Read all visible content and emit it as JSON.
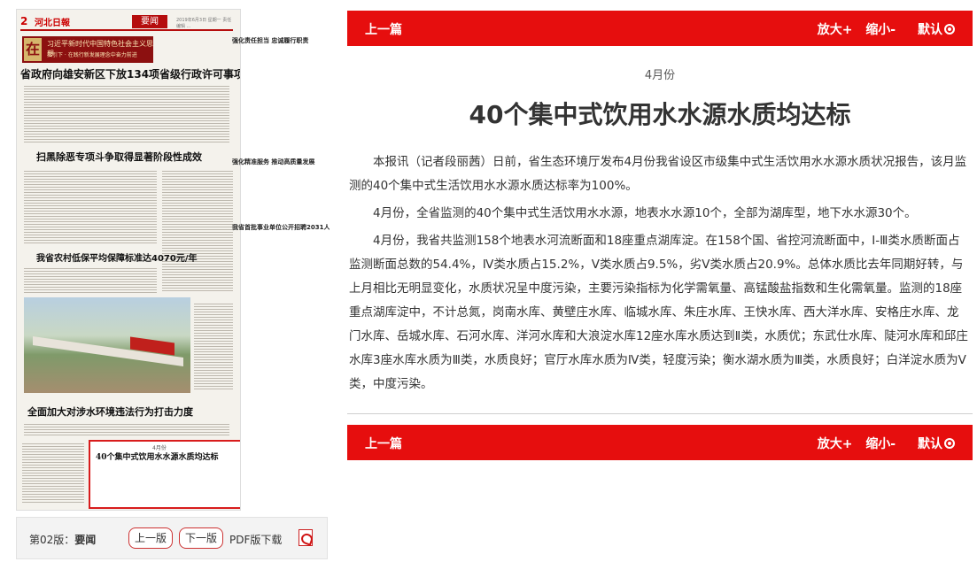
{
  "paper": {
    "page_number": "2",
    "logo": "河北日報",
    "section": "要闻",
    "date_line": "2019年6月3日 星期一 责任编辑 ...",
    "banner_char": "在",
    "banner_line1": "习近平新时代中国特色社会主义思想",
    "banner_line2": "指引下 · 在践行新发展理念中奋力前进",
    "headlines": [
      "省政府向雄安新区下放134项省级行政许可事项",
      "扫黑除恶专项斗争取得显著阶段性成效",
      "我省农村低保平均保障标准达4070元/年",
      "全面加大对涉水环境违法行为打击力度"
    ],
    "side_headlines": [
      "强化责任担当 忠诚履行职责",
      "强化精准服务 推动高质量发展",
      "我省首批事业单位公开招聘2031人"
    ],
    "highlight_month": "4月份",
    "highlight_title": "40个集中式饮用水水源水质均达标"
  },
  "page_nav": {
    "page_label": "第02版：",
    "page_name": "要闻",
    "prev_page": "上一版",
    "next_page": "下一版",
    "pdf_label": "PDF版下载",
    "pdf_icon": "pdf-icon"
  },
  "toolbar": {
    "prev": "上一篇",
    "zoom_in": "放大+",
    "zoom_out": "缩小-",
    "reset": "默认",
    "reset_icon": "circle-dot-icon"
  },
  "article": {
    "intitle": "4月份",
    "title": "40个集中式饮用水水源水质均达标",
    "paragraphs": [
      "本报讯（记者段丽茜）日前，省生态环境厅发布4月份我省设区市级集中式生活饮用水水源水质状况报告，该月监测的40个集中式生活饮用水水源水质达标率为100%。",
      "4月份，全省监测的40个集中式生活饮用水水源，地表水水源10个，全部为湖库型，地下水水源30个。",
      "4月份，我省共监测158个地表水河流断面和18座重点湖库淀。在158个国、省控河流断面中，Ⅰ-Ⅲ类水质断面占监测断面总数的54.4%，Ⅳ类水质占15.2%，Ⅴ类水质占9.5%，劣Ⅴ类水质占20.9%。总体水质比去年同期好转，与上月相比无明显变化，水质状况呈中度污染，主要污染指标为化学需氧量、高锰酸盐指数和生化需氧量。监测的18座重点湖库淀中，不计总氮，岗南水库、黄壁庄水库、临城水库、朱庄水库、王快水库、西大洋水库、安格庄水库、龙门水库、岳城水库、石河水库、洋河水库和大浪淀水库12座水库水质达到Ⅱ类，水质优；东武仕水库、陡河水库和邱庄水库3座水库水质为Ⅲ类，水质良好；官厅水库水质为Ⅳ类，轻度污染；衡水湖水质为Ⅲ类，水质良好；白洋淀水质为Ⅴ类，中度污染。"
    ]
  },
  "colors": {
    "accent_red": "#e60e0e",
    "highlight_border": "#d81c1c"
  }
}
